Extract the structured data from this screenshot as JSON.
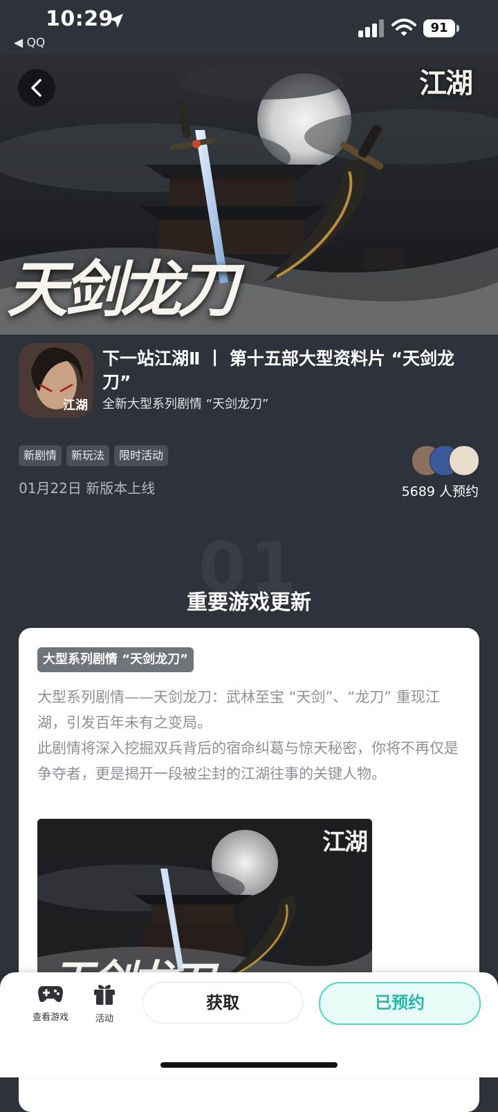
{
  "status_bar": {
    "time": "10:29",
    "back_app": "◀ QQ",
    "battery": "91"
  },
  "hero": {
    "logo_text": "江湖",
    "title_art": "天剑龙刀"
  },
  "game": {
    "title": "下一站江湖Ⅱ 丨 第十五部大型资料片 “天剑龙刀”",
    "subtitle": "全新大型系列剧情 “天剑龙刀”",
    "icon_logo": "江湖"
  },
  "tags": [
    "新剧情",
    "新玩法",
    "限时活动"
  ],
  "release": "01月22日 新版本上线",
  "reservations": "5689 人预约",
  "section": {
    "number": "01",
    "title": "重要游戏更新"
  },
  "card": {
    "badge": "大型系列剧情 “天剑龙刀”",
    "paragraph": "大型系列剧情——天剑龙刀：武林至宝 “天剑”、“龙刀” 重现江湖，引发百年未有之变局。\n此剧情将深入挖掘双兵背后的宿命纠葛与惊天秘密，你将不再仅是争夺者，更是揭开一段被尘封的江湖往事的关键人物。",
    "image_logo": "江湖",
    "image_title_art": "天剑龙刀"
  },
  "bottom_nav": {
    "view_game": "查看游戏",
    "activity": "活动",
    "get_button": "获取",
    "reserved_button": "已预约"
  },
  "colors": {
    "accent": "#23b9a6",
    "accent_border": "#4fd6c4",
    "background": "#2e323b"
  },
  "icons": [
    "location-arrow-icon",
    "signal-icon",
    "wifi-icon",
    "battery-icon",
    "back-chevron-icon",
    "gamepad-icon",
    "gift-icon"
  ]
}
